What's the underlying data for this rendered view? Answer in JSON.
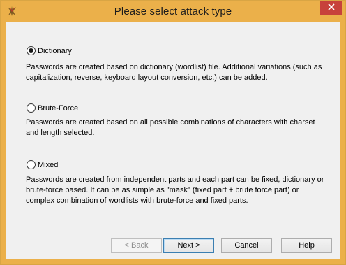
{
  "window": {
    "title": "Please select attack type",
    "accent": "#ebb04a",
    "close_color": "#c7423b"
  },
  "options": [
    {
      "label": "Dictionary",
      "checked": true,
      "description": "Passwords are created based on dictionary (wordlist) file. Additional variations (such as capitalization, reverse, keyboard layout conversion, etc.) can be added."
    },
    {
      "label": "Brute-Force",
      "checked": false,
      "description": "Passwords are created based on all possible combinations of characters with charset and length selected."
    },
    {
      "label": "Mixed",
      "checked": false,
      "description": "Passwords are created from independent parts and each part can be fixed, dictionary or brute-force based. It can be as simple as \"mask\" (fixed part + brute force part) or complex combination of wordlists with brute-force and fixed parts."
    }
  ],
  "buttons": {
    "back": "< Back",
    "next": "Next >",
    "cancel": "Cancel",
    "help": "Help"
  },
  "icons": {
    "app": "app-logo-icon",
    "close": "close-icon"
  }
}
